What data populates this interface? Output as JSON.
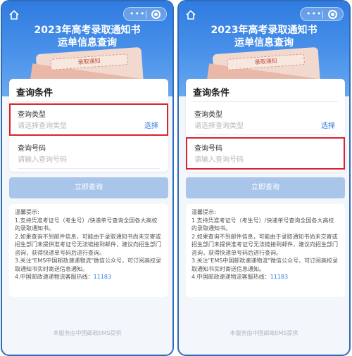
{
  "screens": [
    {
      "header": {
        "title": "2023年高考录取通知书",
        "subtitle": "运单信息查询",
        "envelope_text": "录取通知"
      },
      "card": {
        "title": "查询条件",
        "type_label": "查询类型",
        "type_placeholder": "请选择查询类型",
        "select_label": "选择",
        "number_label": "查询号码",
        "number_placeholder": "请输入查询号码"
      },
      "submit_label": "立即查询",
      "tips": {
        "heading": "温馨提示:",
        "line1": "1.支持凭准考证号（考生号）/快递单号查询全国各大高校的录取通知书。",
        "line2": "2.如果查询不到邮件信息，可能由于录取通知书尚未交寄或招生部门未提供准考证号无法链接到邮件，建议向招生部门咨询，获得快递单号码后进行查询。",
        "line3": "3.关注\"EMS中国邮政速递物流\"微信公众号，可订阅高校录取通知书实时寄送信息通知。",
        "line4_prefix": "4.中国邮政速递物流客服热线：",
        "hotline": "11183"
      },
      "footer": "本服务由中国邮政EMS提供",
      "highlighted_field": "type"
    },
    {
      "header": {
        "title": "2023年高考录取通知书",
        "subtitle": "运单信息查询",
        "envelope_text": "录取通知"
      },
      "card": {
        "title": "查询条件",
        "type_label": "查询类型",
        "type_placeholder": "请选择查询类型",
        "select_label": "选择",
        "number_label": "查询号码",
        "number_placeholder": "请输入查询号码"
      },
      "submit_label": "立即查询",
      "tips": {
        "heading": "温馨提示:",
        "line1": "1.支持凭准考证号（考生号）/快递单号查询全国各大高校的录取通知书。",
        "line2": "2.如果查询不到邮件信息，可能由于录取通知书尚未交寄或招生部门未提供准考证号无法链接到邮件，建议向招生部门咨询，获得快递单号码后进行查询。",
        "line3": "3.关注\"EMS中国邮政速递物流\"微信公众号，可订阅高校录取通知书实时寄送信息通知。",
        "line4_prefix": "4.中国邮政速递物流客服热线：",
        "hotline": "11183"
      },
      "footer": "本服务由中国邮政EMS提供",
      "highlighted_field": "number"
    }
  ],
  "colors": {
    "header_blue": "#2f7be0",
    "highlight_red": "#d9232d",
    "button_disabled": "#a9c6ea",
    "link_blue": "#2f7be0"
  }
}
